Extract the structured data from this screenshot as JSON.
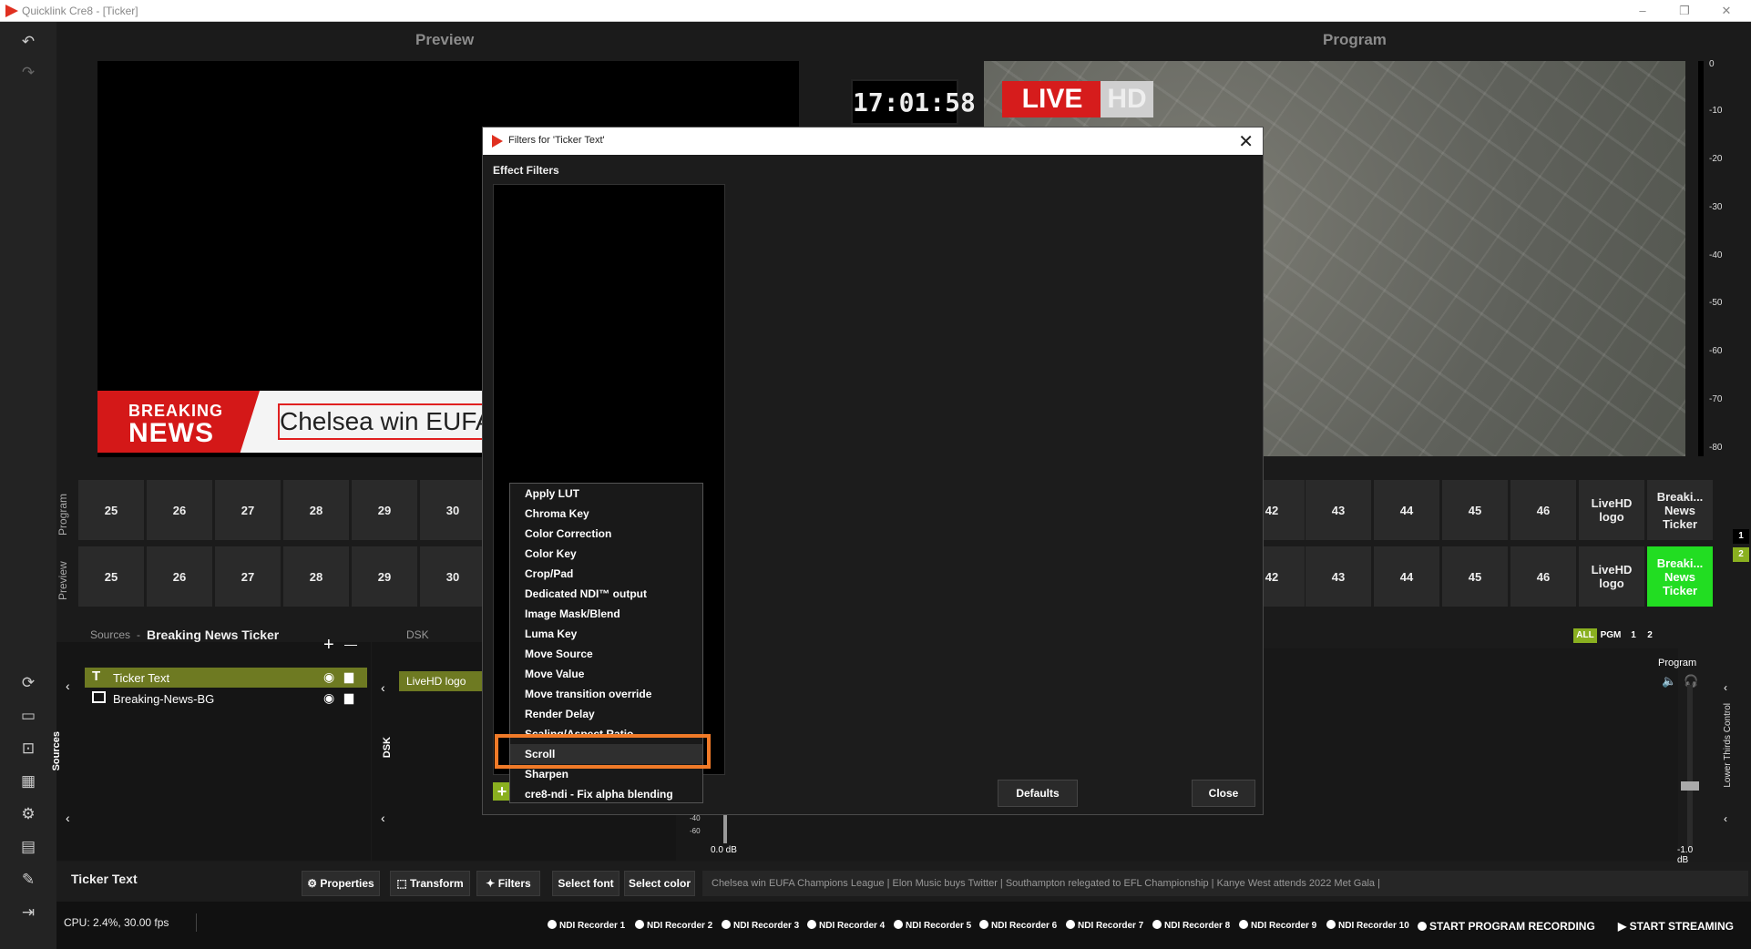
{
  "app": {
    "title": "Quicklink Cre8  - [Ticker]",
    "minimize": "–",
    "maximize": "❐",
    "close": "✕"
  },
  "headers": {
    "preview": "Preview",
    "program": "Program"
  },
  "preview": {
    "breaking_line1": "BREAKING",
    "breaking_line2": "NEWS",
    "ticker_text": "Chelsea win EUFA"
  },
  "clock": "17:01:58",
  "program": {
    "live": "LIVE",
    "hd": "HD"
  },
  "meter_labels": [
    "0",
    "-10",
    "-20",
    "-30",
    "-40",
    "-50",
    "-60",
    "-70",
    "-80"
  ],
  "rows": {
    "program": "Program",
    "preview": "Preview"
  },
  "buttons_left": [
    "25",
    "26",
    "27",
    "28",
    "29",
    "30"
  ],
  "buttons_right": [
    "42",
    "43",
    "44",
    "45",
    "46",
    "LiveHD logo",
    "Breaki... News Ticker"
  ],
  "layer_badges": {
    "one": "1",
    "two": "2"
  },
  "filter_tabs": [
    "ALL",
    "PGM",
    "1",
    "2"
  ],
  "sources": {
    "label": "Sources",
    "separator": "-",
    "scene": "Breaking News Ticker",
    "add": "+",
    "remove": "—",
    "vertical_label": "Sources",
    "items": [
      {
        "name": "Ticker Text",
        "selected": true
      },
      {
        "name": "Breaking-News-BG",
        "selected": false
      }
    ]
  },
  "dsk": {
    "label": "DSK",
    "vertical_label": "DSK",
    "item": "LiveHD logo"
  },
  "audio": {
    "program_label": "Program",
    "db_left": "0.0 dB",
    "db_right": "-1.0 dB",
    "scale_40": "-40",
    "scale_60": "-60",
    "lower_thirds": "Lower Thirds Control"
  },
  "toolbar": {
    "selected_source": "Ticker Text",
    "properties": "Properties",
    "transform": "Transform",
    "filters": "Filters",
    "select_font": "Select font",
    "select_color": "Select color",
    "news_ticker": "Chelsea win EUFA Champions League   |   Elon Music buys Twitter   |   Southampton relegated to EFL Championship   |   Kanye West attends 2022 Met Gala   |"
  },
  "status": {
    "cpu": "CPU: 2.4%, 30.00 fps",
    "recorders": [
      "NDI Recorder 1",
      "NDI Recorder 2",
      "NDI Recorder 3",
      "NDI Recorder 4",
      "NDI Recorder 5",
      "NDI Recorder 6",
      "NDI Recorder 7",
      "NDI Recorder 8",
      "NDI Recorder 9",
      "NDI Recorder 10"
    ],
    "start_recording": "START PROGRAM RECORDING",
    "start_streaming": "START STREAMING"
  },
  "dialog": {
    "title": "Filters for 'Ticker Text'",
    "close_x": "✕",
    "effect_filters": "Effect Filters",
    "add": "+",
    "defaults": "Defaults",
    "close": "Close"
  },
  "menu": {
    "items": [
      "Apply LUT",
      "Chroma Key",
      "Color Correction",
      "Color Key",
      "Crop/Pad",
      "Dedicated NDI™ output",
      "Image Mask/Blend",
      "Luma Key",
      "Move Source",
      "Move Value",
      "Move transition override",
      "Render Delay",
      "Scaling/Aspect Ratio",
      "Scroll",
      "Sharpen",
      "cre8-ndi - Fix alpha blending"
    ],
    "highlighted": "Scroll"
  },
  "colors": {
    "accent_green": "#22dd22",
    "highlight_orange": "#f07a28",
    "breaking_red": "#d41818",
    "source_selected": "#6e7a22"
  }
}
